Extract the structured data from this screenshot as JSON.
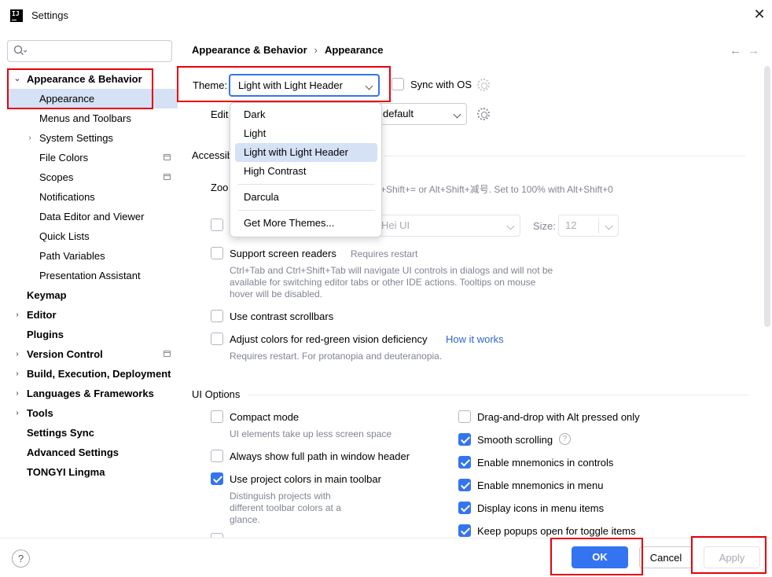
{
  "window": {
    "title": "Settings",
    "app_icon_text": "IJ",
    "close_glyph": "✕"
  },
  "sidebar": {
    "search_placeholder": "",
    "items": [
      {
        "label": "Appearance & Behavior",
        "bold": true,
        "expanded": true
      },
      {
        "label": "Appearance",
        "selected": true
      },
      {
        "label": "Menus and Toolbars"
      },
      {
        "label": "System Settings",
        "collapsed": true
      },
      {
        "label": "File Colors",
        "badge": true
      },
      {
        "label": "Scopes",
        "badge": true
      },
      {
        "label": "Notifications"
      },
      {
        "label": "Data Editor and Viewer"
      },
      {
        "label": "Quick Lists"
      },
      {
        "label": "Path Variables"
      },
      {
        "label": "Presentation Assistant"
      },
      {
        "label": "Keymap",
        "bold": true
      },
      {
        "label": "Editor",
        "bold": true,
        "collapsed": true
      },
      {
        "label": "Plugins",
        "bold": true
      },
      {
        "label": "Version Control",
        "bold": true,
        "collapsed": true,
        "badge": true
      },
      {
        "label": "Build, Execution, Deployment",
        "bold": true,
        "collapsed": true
      },
      {
        "label": "Languages & Frameworks",
        "bold": true,
        "collapsed": true
      },
      {
        "label": "Tools",
        "bold": true,
        "collapsed": true
      },
      {
        "label": "Settings Sync",
        "bold": true
      },
      {
        "label": "Advanced Settings",
        "bold": true
      },
      {
        "label": "TONGYI Lingma",
        "bold": true
      }
    ]
  },
  "breadcrumb": {
    "parent": "Appearance & Behavior",
    "separator": "›",
    "current": "Appearance"
  },
  "nav": {
    "back": "←",
    "forward": "→"
  },
  "theme": {
    "label": "Theme:",
    "value": "Light with Light Header",
    "sync_label": "Sync with OS",
    "sync_checked": false
  },
  "editor_scheme": {
    "label_partial": "Edit",
    "value_partial": "default"
  },
  "accessibility": {
    "header_partial": "Accessib",
    "zoom_label_partial": "Zoo",
    "zoom_hint_partial": "+Shift+= or Alt+Shift+减号. Set to 100% with Alt+Shift+0",
    "font_value_partial": "Hei UI",
    "size_label": "Size:",
    "size_value": "12",
    "screen_readers_label": "Support screen readers",
    "screen_readers_note": "Requires restart",
    "screen_readers_desc_1": "Ctrl+Tab and Ctrl+Shift+Tab will navigate UI controls in dialogs and will not be",
    "screen_readers_desc_2": "available for switching editor tabs or other IDE actions. Tooltips on mouse",
    "screen_readers_desc_3": "hover will be disabled.",
    "contrast_label": "Use contrast scrollbars",
    "redgreen_label": "Adjust colors for red-green vision deficiency",
    "redgreen_link": "How it works",
    "redgreen_desc": "Requires restart. For protanopia and deuteranopia."
  },
  "ui_options": {
    "header": "UI Options",
    "compact_label": "Compact mode",
    "compact_desc": "UI elements take up less screen space",
    "fullpath_label": "Always show full path in window header",
    "projcolors_label": "Use project colors in main toolbar",
    "projcolors_desc_1": "Distinguish projects with",
    "projcolors_desc_2": "different toolbar colors at a",
    "projcolors_desc_3": "glance.",
    "dnd_label": "Drag-and-drop with Alt pressed only",
    "smooth_label": "Smooth scrolling",
    "mnem_controls_label": "Enable mnemonics in controls",
    "mnem_menu_label": "Enable mnemonics in menu",
    "icons_menu_label": "Display icons in menu items",
    "popups_label": "Keep popups open for toggle items"
  },
  "theme_popup": {
    "items": [
      "Dark",
      "Light",
      "Light with Light Header",
      "High Contrast",
      "Darcula",
      "Get More Themes..."
    ],
    "selected": "Light with Light Header"
  },
  "footer": {
    "help": "?",
    "ok": "OK",
    "cancel": "Cancel",
    "apply": "Apply"
  },
  "colors": {
    "accent": "#3574f0",
    "selection": "#d5e1f5",
    "highlight": "#e8000b"
  }
}
